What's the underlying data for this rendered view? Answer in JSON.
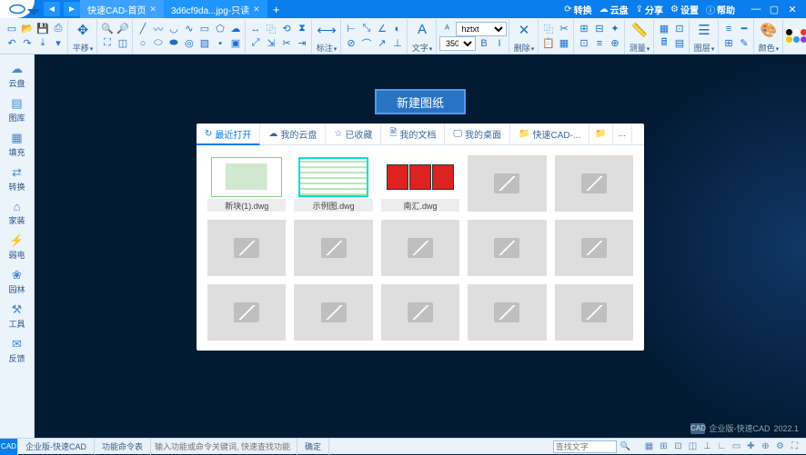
{
  "titlebar": {
    "tabs": [
      {
        "label": "快速CAD-首页",
        "active": true
      },
      {
        "label": "3d6cf9da...jpg-只读",
        "active": false
      }
    ],
    "actions": {
      "convert": "转换",
      "cloud": "云盘",
      "share": "分享",
      "settings": "设置",
      "help": "帮助"
    }
  },
  "ribbon": {
    "pan": "平移",
    "annotate": "标注",
    "text": "文字",
    "font_name": "hztxt",
    "font_size": "350",
    "delete": "删除",
    "measure": "测量",
    "layer": "图层",
    "color": "颜色",
    "dots": [
      "#000",
      "#fff",
      "#e33",
      "#3c3",
      "#ec0",
      "#39e",
      "#93e",
      "#666"
    ]
  },
  "sidebar": [
    {
      "icon": "☁",
      "label": "云盘"
    },
    {
      "icon": "▤",
      "label": "图库"
    },
    {
      "icon": "▦",
      "label": "填充"
    },
    {
      "icon": "⇄",
      "label": "转换"
    },
    {
      "icon": "⌂",
      "label": "家装"
    },
    {
      "icon": "⚡",
      "label": "弱电"
    },
    {
      "icon": "❀",
      "label": "园林"
    },
    {
      "icon": "⚒",
      "label": "工具"
    },
    {
      "icon": "✉",
      "label": "反馈"
    }
  ],
  "center": {
    "new_label": "新建图纸",
    "tabs": [
      {
        "icon": "↻",
        "label": "最近打开",
        "active": true
      },
      {
        "icon": "☁",
        "label": "我的云盘"
      },
      {
        "icon": "☆",
        "label": "已收藏"
      },
      {
        "icon": "🖹",
        "label": "我的文档"
      },
      {
        "icon": "🖵",
        "label": "我的桌面"
      },
      {
        "icon": "📁",
        "label": "快速CAD-..."
      }
    ],
    "files": [
      "新块(1).dwg",
      "示例图.dwg",
      "南汇.dwg"
    ]
  },
  "watermark": {
    "brand": "企业版-快速CAD",
    "version": "2022.1"
  },
  "status": {
    "brand": "企业版-快速CAD",
    "cmdtable": "功能命令表",
    "hint": "输入功能或命令关键词, 快速查找功能",
    "ok": "确定",
    "search_ph": "查找文字"
  }
}
